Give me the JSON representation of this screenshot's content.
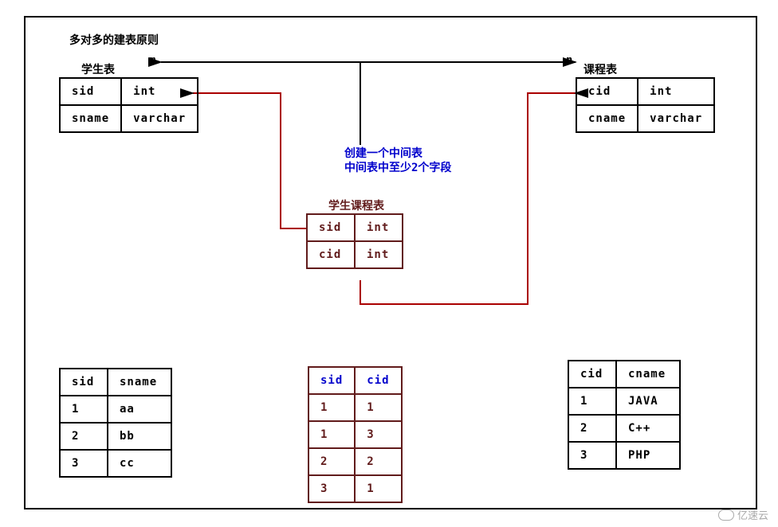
{
  "page_title": "多对多的建表原则",
  "labels": {
    "student_table": "学生表",
    "course_table": "课程表",
    "join_table": "学生课程表",
    "m": "m",
    "n": "n",
    "annotation_line1": "创建一个中间表",
    "annotation_line2": "中间表中至少2个字段"
  },
  "student_schema": {
    "rows": [
      {
        "col": "sid",
        "type": "int"
      },
      {
        "col": "sname",
        "type": "varchar"
      }
    ]
  },
  "course_schema": {
    "rows": [
      {
        "col": "cid",
        "type": "int"
      },
      {
        "col": "cname",
        "type": "varchar"
      }
    ]
  },
  "join_schema": {
    "rows": [
      {
        "col": "sid",
        "type": "int"
      },
      {
        "col": "cid",
        "type": "int"
      }
    ]
  },
  "student_data": {
    "header": {
      "c1": "sid",
      "c2": "sname"
    },
    "rows": [
      {
        "c1": "1",
        "c2": "aa"
      },
      {
        "c1": "2",
        "c2": "bb"
      },
      {
        "c1": "3",
        "c2": "cc"
      }
    ]
  },
  "join_data": {
    "header": {
      "c1": "sid",
      "c2": "cid"
    },
    "rows": [
      {
        "c1": "1",
        "c2": "1"
      },
      {
        "c1": "1",
        "c2": "3"
      },
      {
        "c1": "2",
        "c2": "2"
      },
      {
        "c1": "3",
        "c2": "1"
      }
    ]
  },
  "course_data": {
    "header": {
      "c1": "cid",
      "c2": "cname"
    },
    "rows": [
      {
        "c1": "1",
        "c2": "JAVA"
      },
      {
        "c1": "2",
        "c2": "C++"
      },
      {
        "c1": "3",
        "c2": "PHP"
      }
    ]
  },
  "watermark": "亿速云"
}
